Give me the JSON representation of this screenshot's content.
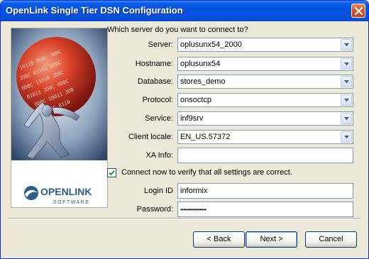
{
  "window": {
    "title": "OpenLink Single Tier DSN Configuration"
  },
  "logo": {
    "brand": "OPENLINK",
    "sub": "SOFTWARE"
  },
  "form": {
    "prompt": "Which server do you want to connect to?",
    "server": {
      "label": "Server:",
      "value": "oplusunx54_2000"
    },
    "hostname": {
      "label": "Hostname:",
      "value": "oplusunx54"
    },
    "database": {
      "label": "Database:",
      "value": "stores_demo"
    },
    "protocol": {
      "label": "Protocol:",
      "value": "onsoctcp"
    },
    "service": {
      "label": "Service:",
      "value": "inf9srv"
    },
    "client_locale": {
      "label": "Client locale:",
      "value": "EN_US.57372"
    },
    "xa_info": {
      "label": "XA Info:",
      "value": ""
    },
    "connect_now": {
      "label": "Connect now to verify that all settings are correct.",
      "checked": true
    },
    "login_id": {
      "label": "Login ID",
      "value": "informix"
    },
    "password": {
      "label": "Password:",
      "value": "••••••••••••••••"
    }
  },
  "buttons": {
    "back": "< Back",
    "next": "Next >",
    "cancel": "Cancel"
  }
}
